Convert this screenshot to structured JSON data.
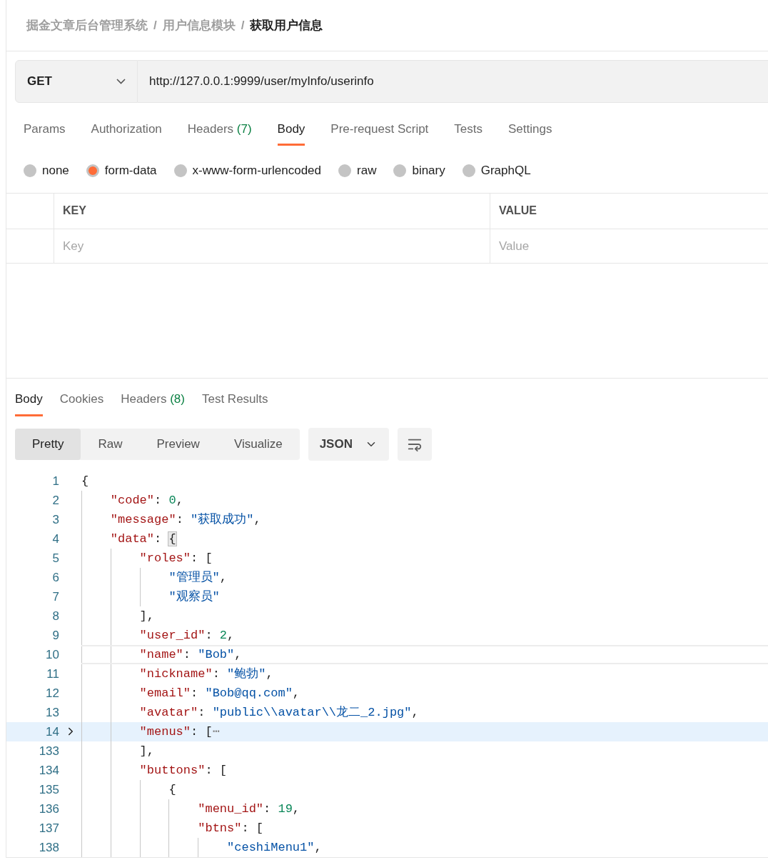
{
  "breadcrumb": [
    {
      "text": "掘金文章后台管理系统",
      "current": false
    },
    {
      "text": "用户信息模块",
      "current": false
    },
    {
      "text": "获取用户信息",
      "current": true
    }
  ],
  "breadcrumb_separator": "/",
  "request": {
    "method": "GET",
    "url": "http://127.0.0.1:9999/user/myInfo/userinfo"
  },
  "request_tabs": [
    {
      "label": "Params",
      "selected": false
    },
    {
      "label": "Authorization",
      "selected": false
    },
    {
      "label": "Headers",
      "count": "(7)",
      "selected": false
    },
    {
      "label": "Body",
      "selected": true
    },
    {
      "label": "Pre-request Script",
      "selected": false
    },
    {
      "label": "Tests",
      "selected": false
    },
    {
      "label": "Settings",
      "selected": false
    }
  ],
  "body_types": [
    {
      "label": "none",
      "selected": false
    },
    {
      "label": "form-data",
      "selected": true
    },
    {
      "label": "x-www-form-urlencoded",
      "selected": false
    },
    {
      "label": "raw",
      "selected": false
    },
    {
      "label": "binary",
      "selected": false
    },
    {
      "label": "GraphQL",
      "selected": false
    }
  ],
  "params_table": {
    "columns": [
      "KEY",
      "VALUE"
    ],
    "placeholders": [
      "Key",
      "Value"
    ]
  },
  "response_tabs": [
    {
      "label": "Body",
      "selected": true
    },
    {
      "label": "Cookies",
      "selected": false
    },
    {
      "label": "Headers",
      "count": "(8)",
      "selected": false
    },
    {
      "label": "Test Results",
      "selected": false
    }
  ],
  "view_modes": [
    {
      "label": "Pretty",
      "selected": true
    },
    {
      "label": "Raw",
      "selected": false
    },
    {
      "label": "Preview",
      "selected": false
    },
    {
      "label": "Visualize",
      "selected": false
    }
  ],
  "format": "JSON",
  "code_lines": [
    {
      "number": "1",
      "tokens": [
        {
          "kind": "punct",
          "text": "{"
        }
      ]
    },
    {
      "number": "2",
      "tokens": [
        {
          "kind": "key",
          "text": "    \"code\""
        },
        {
          "kind": "punct",
          "text": ": "
        },
        {
          "kind": "num",
          "text": "0"
        },
        {
          "kind": "punct",
          "text": ","
        }
      ]
    },
    {
      "number": "3",
      "tokens": [
        {
          "kind": "key",
          "text": "    \"message\""
        },
        {
          "kind": "punct",
          "text": ": "
        },
        {
          "kind": "str",
          "text": "\"获取成功\""
        },
        {
          "kind": "punct",
          "text": ","
        }
      ]
    },
    {
      "number": "4",
      "tokens": [
        {
          "kind": "key",
          "text": "    \"data\""
        },
        {
          "kind": "punct",
          "text": ": "
        },
        {
          "kind": "match",
          "text": "{"
        }
      ]
    },
    {
      "number": "5",
      "tokens": [
        {
          "kind": "key",
          "text": "        \"roles\""
        },
        {
          "kind": "punct",
          "text": ": ["
        }
      ]
    },
    {
      "number": "6",
      "tokens": [
        {
          "kind": "str",
          "text": "            \"管理员\""
        },
        {
          "kind": "punct",
          "text": ","
        }
      ]
    },
    {
      "number": "7",
      "tokens": [
        {
          "kind": "str",
          "text": "            \"观察员\""
        }
      ]
    },
    {
      "number": "8",
      "tokens": [
        {
          "kind": "punct",
          "text": "        ],"
        }
      ]
    },
    {
      "number": "9",
      "tokens": [
        {
          "kind": "key",
          "text": "        \"user_id\""
        },
        {
          "kind": "punct",
          "text": ": "
        },
        {
          "kind": "num",
          "text": "2"
        },
        {
          "kind": "punct",
          "text": ","
        }
      ]
    },
    {
      "number": "10",
      "current": true,
      "tokens": [
        {
          "kind": "key",
          "text": "        \"name\""
        },
        {
          "kind": "punct",
          "text": ": "
        },
        {
          "kind": "str",
          "text": "\"Bob\""
        },
        {
          "kind": "punct",
          "text": ","
        }
      ]
    },
    {
      "number": "11",
      "tokens": [
        {
          "kind": "key",
          "text": "        \"nickname\""
        },
        {
          "kind": "punct",
          "text": ": "
        },
        {
          "kind": "str",
          "text": "\"鲍勃\""
        },
        {
          "kind": "punct",
          "text": ","
        }
      ]
    },
    {
      "number": "12",
      "tokens": [
        {
          "kind": "key",
          "text": "        \"email\""
        },
        {
          "kind": "punct",
          "text": ": "
        },
        {
          "kind": "str",
          "text": "\"Bob@qq.com\""
        },
        {
          "kind": "punct",
          "text": ","
        }
      ]
    },
    {
      "number": "13",
      "tokens": [
        {
          "kind": "key",
          "text": "        \"avatar\""
        },
        {
          "kind": "punct",
          "text": ": "
        },
        {
          "kind": "str",
          "text": "\"public\\\\avatar\\\\龙二_2.jpg\""
        },
        {
          "kind": "punct",
          "text": ","
        }
      ]
    },
    {
      "number": "14",
      "folded": true,
      "tokens": [
        {
          "kind": "key",
          "text": "        \"menus\""
        },
        {
          "kind": "punct",
          "text": ": ["
        },
        {
          "kind": "fold",
          "text": "⋯"
        }
      ]
    },
    {
      "number": "133",
      "tokens": [
        {
          "kind": "punct",
          "text": "        ],"
        }
      ]
    },
    {
      "number": "134",
      "tokens": [
        {
          "kind": "key",
          "text": "        \"buttons\""
        },
        {
          "kind": "punct",
          "text": ": ["
        }
      ]
    },
    {
      "number": "135",
      "tokens": [
        {
          "kind": "punct",
          "text": "            {"
        }
      ]
    },
    {
      "number": "136",
      "tokens": [
        {
          "kind": "key",
          "text": "                \"menu_id\""
        },
        {
          "kind": "punct",
          "text": ": "
        },
        {
          "kind": "num",
          "text": "19"
        },
        {
          "kind": "punct",
          "text": ","
        }
      ]
    },
    {
      "number": "137",
      "tokens": [
        {
          "kind": "key",
          "text": "                \"btns\""
        },
        {
          "kind": "punct",
          "text": ": ["
        }
      ]
    },
    {
      "number": "138",
      "tokens": [
        {
          "kind": "str",
          "text": "                    \"ceshiMenu1\""
        },
        {
          "kind": "punct",
          "text": ","
        }
      ]
    }
  ]
}
